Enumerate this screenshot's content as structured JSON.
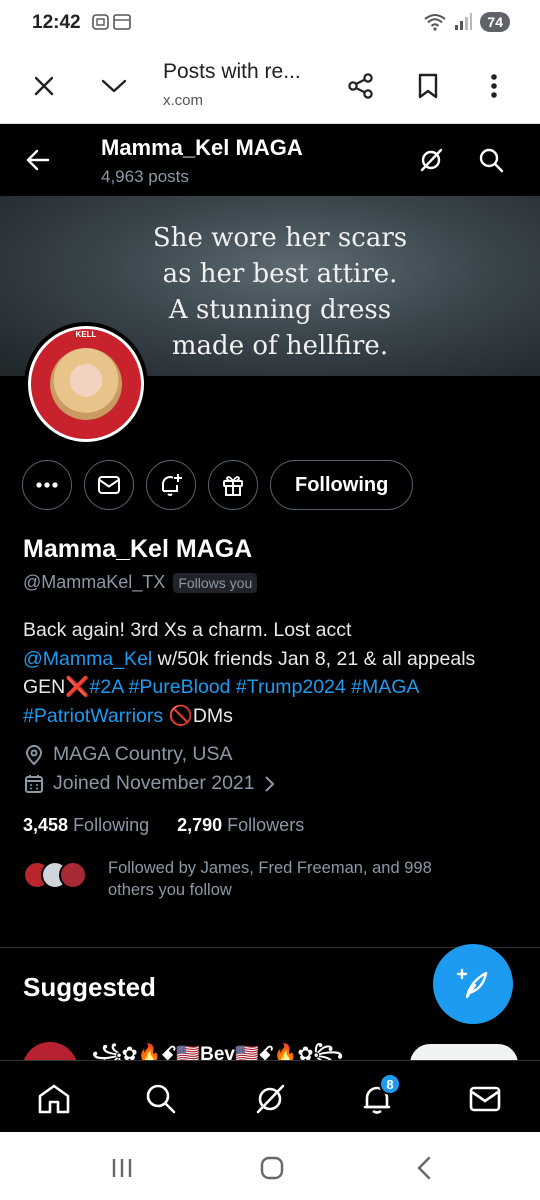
{
  "status_bar": {
    "time": "12:42",
    "battery": "74"
  },
  "browser": {
    "tab_title": "Posts with re...",
    "tab_url": "x.com",
    "icons": [
      "close-icon",
      "chevron-down-icon",
      "share-icon",
      "bookmark-icon",
      "more-vert-icon"
    ]
  },
  "header": {
    "name": "Mamma_Kel MAGA",
    "posts_count": "4,963 posts"
  },
  "banner": {
    "lines": [
      "She wore her scars",
      "as her best attire.",
      "A stunning dress",
      "made of hellfire."
    ]
  },
  "avatar": {
    "ring_text": "KELL"
  },
  "actions": {
    "following_label": "Following"
  },
  "profile": {
    "name": "Mamma_Kel MAGA",
    "handle": "@MammaKel_TX",
    "follows_you": "Follows you",
    "bio": {
      "line1": "Back again! 3rd Xs a charm. Lost acct",
      "mention": "@Mamma_Kel",
      "line2_rest": " w/50k friends Jan 8, 21 & all appeals",
      "gen": "GEN",
      "redx": "❌",
      "tags1": "#2A #PureBlood #Trump2024 #MAGA",
      "tags2": "#PatriotWarriors",
      "no_emoji": "🚫",
      "dms": "DMs"
    },
    "location": "MAGA Country, USA",
    "joined": "Joined November 2021",
    "following_count": "3,458",
    "following_label": "Following",
    "followers_count": "2,790",
    "followers_label": "Followers",
    "followed_by_line1": "Followed by James, Fred Freeman, and 998",
    "followed_by_line2": "others you follow"
  },
  "suggested": {
    "heading": "Suggested",
    "name": "꧁✿🔥ꗃ🇺🇸Bev🇺🇸ꗃ🔥✿꧂"
  },
  "bottom_nav": {
    "notification_badge": "8"
  },
  "colors": {
    "accent": "#1d9bf0",
    "background": "#000000",
    "secondary_text": "#8b98a5"
  }
}
